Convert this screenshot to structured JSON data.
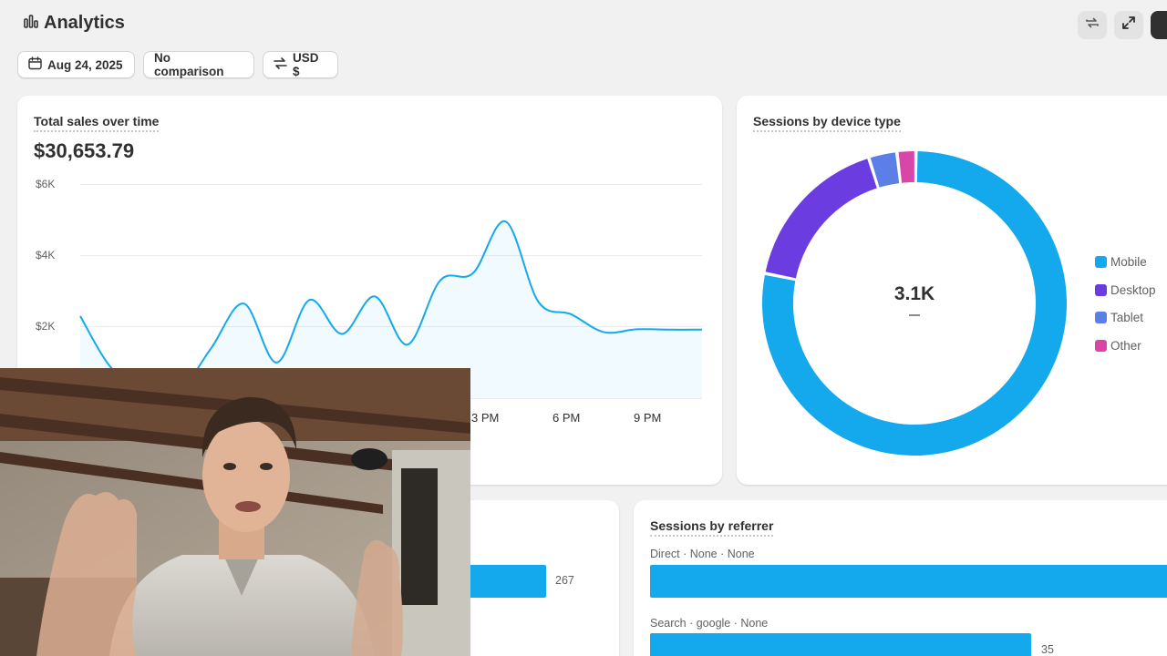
{
  "header": {
    "title": "Analytics",
    "icons": [
      "bar-chart-icon",
      "refresh-icon",
      "fullscreen-icon"
    ]
  },
  "filters": {
    "date": "Aug 24, 2025",
    "comparison": "No comparison",
    "currency": "USD $"
  },
  "sales_card": {
    "title": "Total sales over time",
    "total": "$30,653.79"
  },
  "device_card": {
    "title": "Sessions by device type",
    "center_value": "3.1K",
    "center_sub": "—"
  },
  "referrer_card": {
    "title": "Sessions by referrer",
    "rows": [
      {
        "label": "Direct · None · None"
      },
      {
        "label": "Search · google · None",
        "value": "35"
      }
    ]
  },
  "left_bottom_card": {
    "bar_value": "267"
  },
  "colors": {
    "accent": "#13a9ec",
    "mobile": "#13a9ec",
    "desktop": "#6b3de0",
    "tablet": "#5b7fe6",
    "other": "#d946a8"
  },
  "chart_data": [
    {
      "type": "line",
      "title": "Total sales over time",
      "y_ticks": [
        "$6K",
        "$4K",
        "$2K"
      ],
      "x_ticks": [
        "3 PM",
        "6 PM",
        "9 PM"
      ],
      "ylim": [
        0,
        6000
      ],
      "x": [
        "13:00",
        "13:30",
        "14:00",
        "14:30",
        "15:00",
        "15:30",
        "16:00",
        "16:30",
        "17:00",
        "17:30",
        "18:00",
        "18:30",
        "19:00",
        "19:30",
        "20:00",
        "20:30",
        "21:00",
        "21:30",
        "22:00",
        "22:30"
      ],
      "series": [
        {
          "values": [
            2300,
            800,
            500,
            200,
            1400,
            2650,
            1000,
            2750,
            1800,
            2850,
            1500,
            3300,
            3500,
            4950,
            2700,
            2350,
            1850,
            1930,
            1920,
            1920
          ]
        }
      ]
    },
    {
      "type": "pie",
      "title": "Sessions by device type",
      "labels": [
        "Mobile",
        "Desktop",
        "Tablet",
        "Other"
      ],
      "values": [
        78,
        17,
        3,
        2
      ]
    }
  ]
}
